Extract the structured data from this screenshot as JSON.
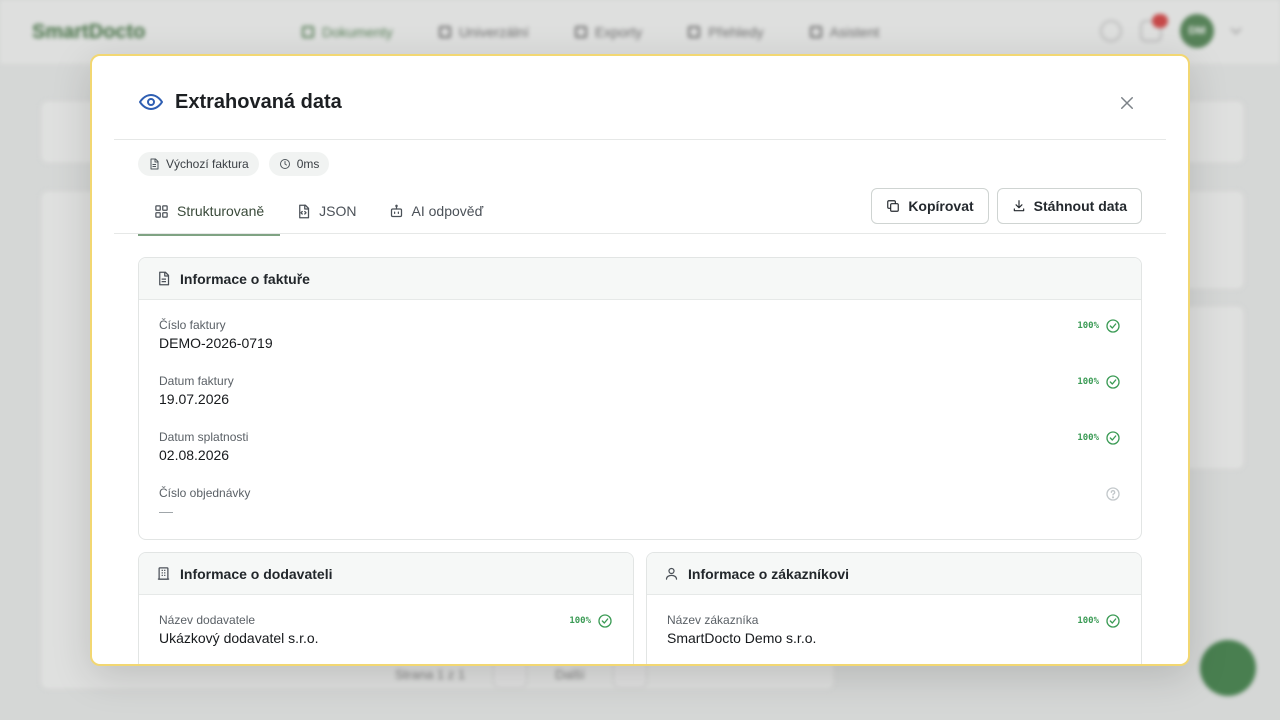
{
  "background": {
    "brand": "SmartDocto",
    "nav": [
      "Dokumenty",
      "Univerzální",
      "Exporty",
      "Přehledy",
      "Asistent"
    ],
    "user_initials": "DM",
    "footer_text": [
      "Strana 1 z 1",
      "Další"
    ]
  },
  "modal": {
    "title": "Extrahovaná data",
    "close_label": "×",
    "chips": [
      {
        "icon": "document-icon",
        "label": "Výchozí faktura"
      },
      {
        "icon": "clock-icon",
        "label": "0ms"
      }
    ],
    "tabs": [
      {
        "icon": "grid-icon",
        "label": "Strukturovaně",
        "active": true
      },
      {
        "icon": "code-file-icon",
        "label": "JSON",
        "active": false
      },
      {
        "icon": "robot-icon",
        "label": "AI odpověď",
        "active": false
      }
    ],
    "actions": {
      "copy_label": "Kopírovat",
      "download_label": "Stáhnout data"
    }
  },
  "sections": {
    "invoice": {
      "title": "Informace o faktuře",
      "fields": [
        {
          "label": "Číslo faktury",
          "value": "DEMO-2026-0719",
          "confidence": "100%"
        },
        {
          "label": "Datum faktury",
          "value": "19.07.2026",
          "confidence": "100%"
        },
        {
          "label": "Datum splatnosti",
          "value": "02.08.2026",
          "confidence": "100%"
        },
        {
          "label": "Číslo objednávky",
          "value": "—",
          "confidence": ""
        }
      ]
    },
    "supplier": {
      "title": "Informace o dodavateli",
      "fields": [
        {
          "label": "Název dodavatele",
          "value": "Ukázkový dodavatel s.r.o.",
          "confidence": "100%"
        }
      ]
    },
    "customer": {
      "title": "Informace o zákazníkovi",
      "fields": [
        {
          "label": "Název zákazníka",
          "value": "SmartDocto Demo s.r.o.",
          "confidence": "100%"
        }
      ]
    }
  },
  "colors": {
    "accent_blue": "#2f5fb3",
    "confidence_green": "#3b9b55",
    "tab_underline": "#7fa383",
    "modal_border": "#f2d772"
  }
}
